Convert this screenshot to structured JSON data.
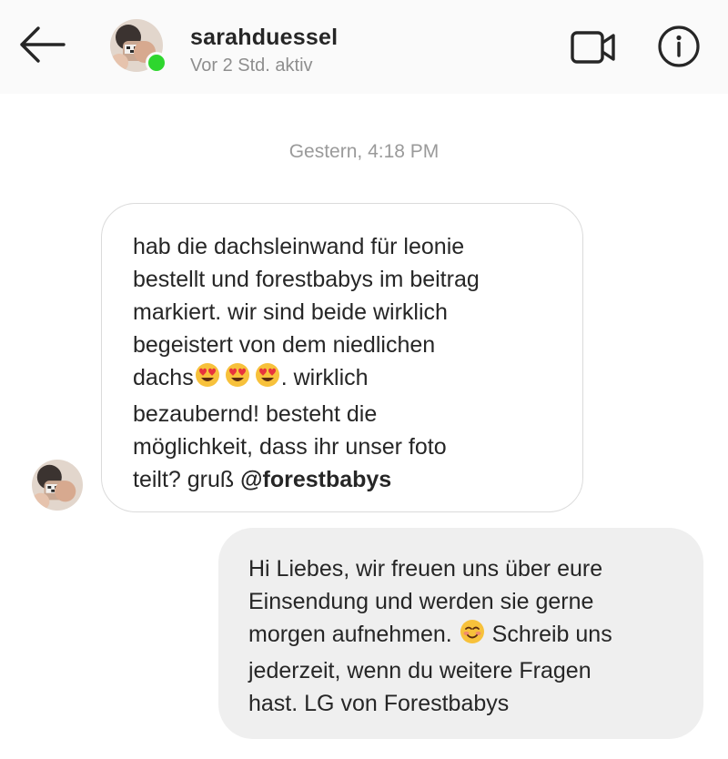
{
  "header": {
    "back_icon": "arrow-left-icon",
    "username": "sarahduessel",
    "status": "Vor 2 Std. aktiv",
    "online_color": "#2ed62e",
    "video_icon": "video-camera-icon",
    "info_icon": "info-circle-icon"
  },
  "thread": {
    "timestamp": "Gestern, 4:18 PM",
    "incoming": {
      "lines": [
        "hab die dachsleinwand für leonie",
        "bestellt und forestbabys im beitrag",
        "markiert. wir sind beide wirklich",
        "begeistert von dem niedlichen",
        "dachs",
        ". wirklich",
        "bezaubernd! besteht die",
        "möglichkeit, dass ihr unser foto",
        "teilt? gruß",
        "@forestbabys"
      ],
      "emoji": "heart-eyes-emoji"
    },
    "outgoing": {
      "lines": [
        "Hi Liebes, wir freuen uns über eure",
        "Einsendung und werden sie gerne",
        "morgen aufnehmen.",
        "Schreib uns",
        "jederzeit, wenn du weitere Fragen",
        "hast. LG von Forestbabys"
      ],
      "emoji": "smiling-blush-emoji"
    }
  },
  "colors": {
    "header_bg": "#fafafa",
    "outgoing_bubble": "#efefef",
    "incoming_border": "#dbdbdb",
    "text": "#262626",
    "muted": "#8e8e8e"
  }
}
